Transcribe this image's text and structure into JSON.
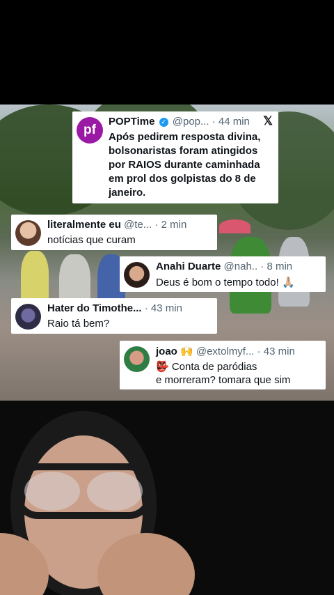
{
  "post": {
    "logo_text": "pf",
    "name": "POPTime",
    "handle": "@pop...",
    "time": "· 44 min",
    "platform_icon": "𝕏",
    "text": "Após pedirem resposta divina, bolsonaristas foram atingidos por RAIOS durante caminhada em prol dos golpistas do 8 de janeiro."
  },
  "comments": [
    {
      "name": "literalmente eu",
      "handle": "@te...",
      "time": "· 2 min",
      "text": "notícias que curam"
    },
    {
      "name": "Anahi Duarte",
      "handle": "@nah..",
      "time": "· 8 min",
      "text": "Deus é bom o tempo todo! 🙏🏼"
    },
    {
      "name": "Hater do Timothe...",
      "handle": "",
      "time": "· 43 min",
      "text": "Raio tá bem?"
    },
    {
      "name": "joao 🙌",
      "handle": "@extolmyf...",
      "time": "· 43 min",
      "badge": "👺 Conta de paródias",
      "text": "e morreram? tomara que sim"
    }
  ]
}
